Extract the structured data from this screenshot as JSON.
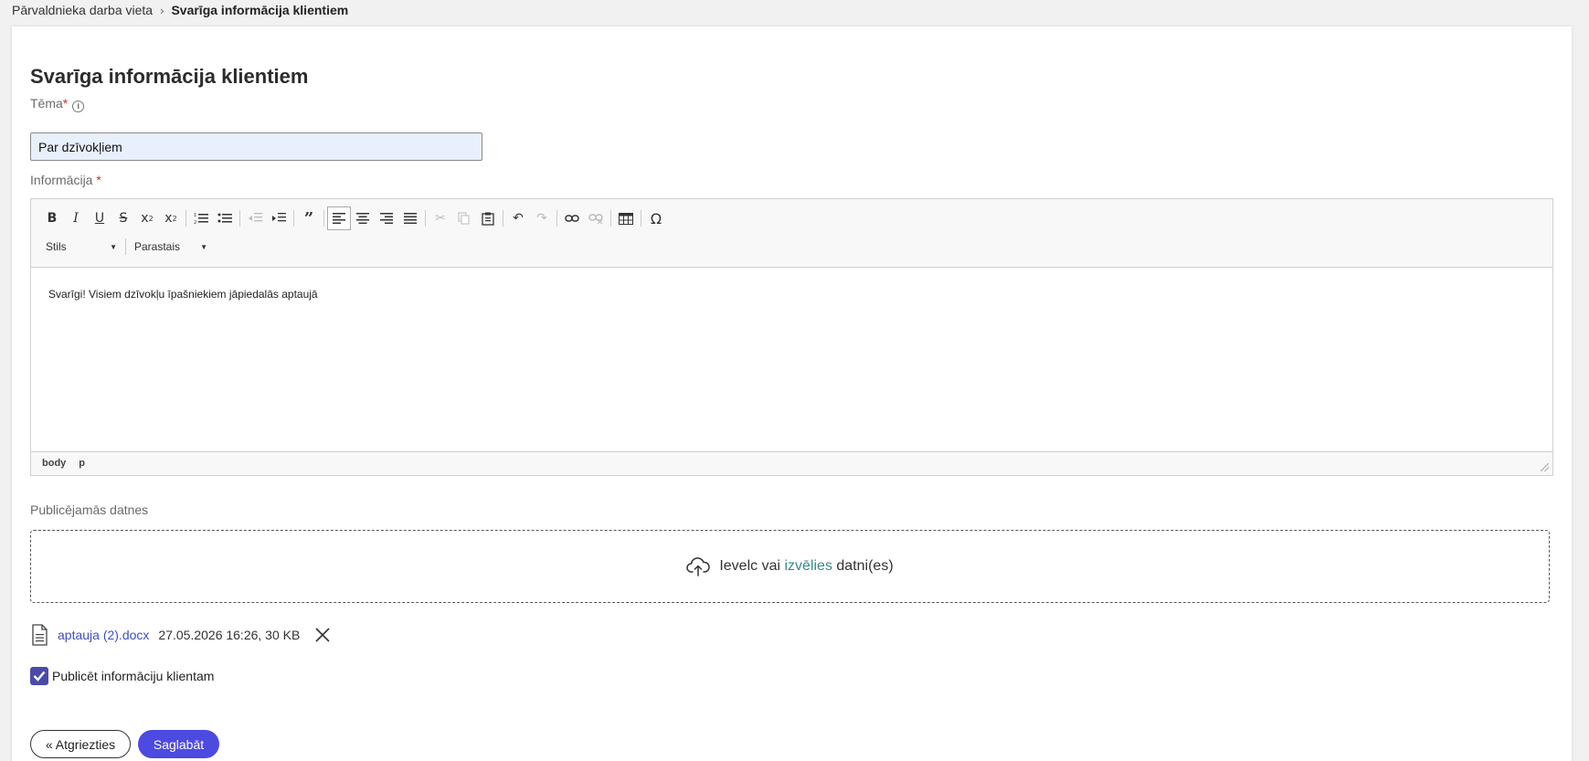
{
  "breadcrumb": {
    "parent": "Pārvaldnieka darba vieta",
    "current": "Svarīga informācija klientiem"
  },
  "page": {
    "title": "Svarīga informācija klientiem"
  },
  "form": {
    "theme_label": "Tēma",
    "theme_required": "*",
    "theme_value": "Par dzīvokļiem",
    "info_label": "Informācija",
    "info_required": "*"
  },
  "editor": {
    "style_combo": "Stils",
    "format_combo": "Parastais",
    "content": "Svarīgi! Visiem dzīvokļu īpašniekiem jāpiedalās aptaujā",
    "path": [
      "body",
      "p"
    ]
  },
  "files": {
    "label": "Publicējamās datnes",
    "drop_prefix": "Ievelc vai",
    "drop_link": "izvēlies",
    "drop_suffix": "datni(es)",
    "items": [
      {
        "name": "aptauja (2).docx",
        "meta": "27.05.2026 16:26, 30 KB"
      }
    ]
  },
  "publish": {
    "label": "Publicēt informāciju klientam",
    "checked": true
  },
  "actions": {
    "back_label": "« Atgriezties",
    "save_label": "Saglabāt"
  },
  "colors": {
    "primary": "#4c4ae0",
    "checkbox": "#4c4aa8",
    "link": "#3c4fc7",
    "input_bg": "#e8f0fd"
  }
}
